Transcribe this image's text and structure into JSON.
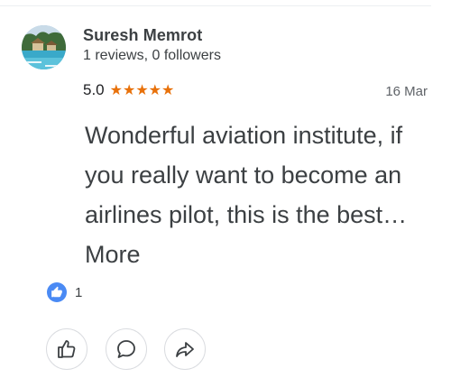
{
  "review": {
    "reviewer_name": "Suresh Memrot",
    "reviewer_meta": "1 reviews, 0 followers",
    "rating": "5.0",
    "stars": "★★★★★",
    "date": "16 Mar",
    "text": "Wonderful aviation institute, if you really want to become an airlines pilot, this is the best…",
    "more_label": "More",
    "like_count": "1"
  },
  "icons": {
    "avatar": "resort-photo-avatar",
    "like_badge": "thumbs-up-icon",
    "like_button": "thumbs-up-outline-icon",
    "comment_button": "comment-bubble-icon",
    "share_button": "share-arrow-icon"
  },
  "colors": {
    "star": "#e8710a",
    "like_badge": "#4a8af4",
    "text": "#3c4043"
  }
}
